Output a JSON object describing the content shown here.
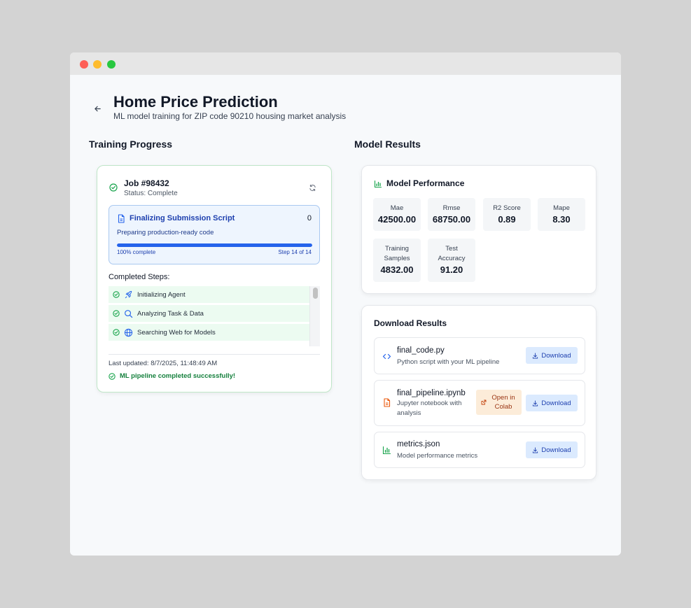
{
  "header": {
    "title": "Home Price Prediction",
    "subtitle": "ML model training for ZIP code 90210 housing market analysis"
  },
  "training": {
    "section_title": "Training Progress",
    "job_title": "Job #98432",
    "job_status": "Status: Complete",
    "current_step": {
      "name": "Finalizing Submission Script",
      "count": "0",
      "description": "Preparing production-ready code",
      "progress_label": "100% complete",
      "progress_fraction": 1.0,
      "step_of": "Step 14 of 14"
    },
    "completed_title": "Completed Steps:",
    "completed_steps": [
      {
        "label": "Initializing Agent",
        "icon": "rocket-icon"
      },
      {
        "label": "Analyzing Task & Data",
        "icon": "search-icon"
      },
      {
        "label": "Searching Web for Models",
        "icon": "globe-icon"
      }
    ],
    "last_updated": "Last updated: 8/7/2025, 11:48:49 AM",
    "success_message": "ML pipeline completed successfully!"
  },
  "results": {
    "section_title": "Model Results",
    "performance": {
      "title": "Model Performance",
      "metrics": [
        {
          "label": "Mae",
          "value": "42500.00"
        },
        {
          "label": "Rmse",
          "value": "68750.00"
        },
        {
          "label": "R2 Score",
          "value": "0.89"
        },
        {
          "label": "Mape",
          "value": "8.30"
        },
        {
          "label": "Training Samples",
          "value": "4832.00"
        },
        {
          "label": "Test Accuracy",
          "value": "91.20"
        }
      ]
    },
    "downloads": {
      "title": "Download Results",
      "download_label": "Download",
      "colab_label": "Open in Colab",
      "files": [
        {
          "name": "final_code.py",
          "description": "Python script with your ML pipeline",
          "icon": "code-icon"
        },
        {
          "name": "final_pipeline.ipynb",
          "description": "Jupyter notebook with analysis",
          "icon": "notebook-icon"
        },
        {
          "name": "metrics.json",
          "description": "Model performance metrics",
          "icon": "bar-chart-icon"
        }
      ]
    }
  },
  "colors": {
    "accent_blue": "#2563eb",
    "success_green": "#16a34a",
    "card_border_green": "#bfe6c8"
  }
}
